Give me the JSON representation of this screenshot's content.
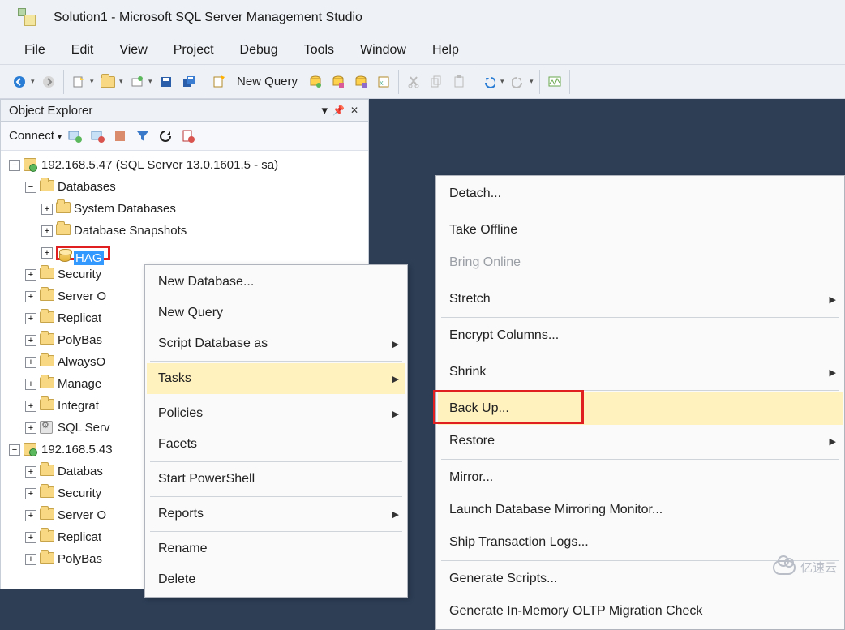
{
  "window": {
    "title": "Solution1 - Microsoft SQL Server Management Studio"
  },
  "menubar": {
    "items": [
      "File",
      "Edit",
      "View",
      "Project",
      "Debug",
      "Tools",
      "Window",
      "Help"
    ]
  },
  "toolbar": {
    "new_query": "New Query"
  },
  "object_explorer": {
    "title": "Object Explorer",
    "connect_label": "Connect",
    "tree": {
      "server1_label": "192.168.5.47 (SQL Server 13.0.1601.5 - sa)",
      "databases": "Databases",
      "system_databases": "System Databases",
      "database_snapshots": "Database Snapshots",
      "selected_db": "HAG",
      "security": "Security",
      "server_objects": "Server O",
      "replication": "Replicat",
      "polybase": "PolyBas",
      "alwayson": "AlwaysO",
      "management": "Manage",
      "integration": "Integrat",
      "sql_service": "SQL Serv",
      "server2_label": "192.168.5.43",
      "databases2": "Databas",
      "security2": "Security",
      "server_objects2": "Server O",
      "replication2": "Replicat",
      "polybase2": "PolyBas"
    }
  },
  "context_menu": {
    "new_database": "New Database...",
    "new_query": "New Query",
    "script_database_as": "Script Database as",
    "tasks": "Tasks",
    "policies": "Policies",
    "facets": "Facets",
    "start_powershell": "Start PowerShell",
    "reports": "Reports",
    "rename": "Rename",
    "delete": "Delete"
  },
  "tasks_submenu": {
    "detach": "Detach...",
    "take_offline": "Take Offline",
    "bring_online": "Bring Online",
    "stretch": "Stretch",
    "encrypt_columns": "Encrypt Columns...",
    "shrink": "Shrink",
    "back_up": "Back Up...",
    "restore": "Restore",
    "mirror": "Mirror...",
    "launch_mirror_monitor": "Launch Database Mirroring Monitor...",
    "ship_logs": "Ship Transaction Logs...",
    "generate_scripts": "Generate Scripts...",
    "generate_oltp": "Generate In-Memory OLTP Migration Check"
  },
  "watermark": {
    "text": "亿速云"
  }
}
